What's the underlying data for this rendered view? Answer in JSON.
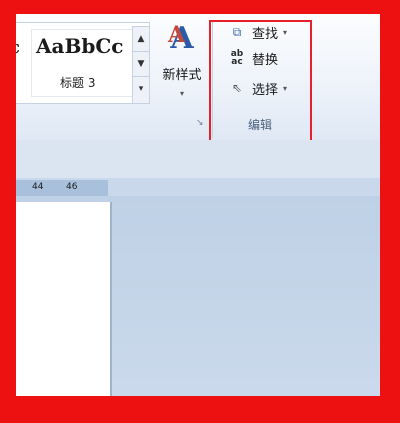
{
  "styles_gallery": {
    "preview_text": "AaBbCc",
    "caption": "标题 3",
    "sliver_text": "c",
    "scroll_up": "▲",
    "scroll_down": "▼",
    "more": "▾"
  },
  "new_style": {
    "label": "新样式",
    "dropdown_arrow": "▾",
    "icon": "style-letter-a-icon"
  },
  "styles_launcher": "↘",
  "editing_group": {
    "title": "编辑",
    "items": [
      {
        "label": "查找",
        "icon": "binoculars-icon",
        "has_dropdown": true,
        "arrow": "▾"
      },
      {
        "label": "替换",
        "icon": "replace-ab-icon",
        "has_dropdown": false
      },
      {
        "label": "选择",
        "icon": "cursor-arrow-icon",
        "has_dropdown": true,
        "arrow": "▾"
      }
    ]
  },
  "ruler": {
    "numbers": [
      "44",
      "46"
    ]
  },
  "colors": {
    "highlight_border": "#e8202a",
    "frame": "#ee1111",
    "ribbon_bg": "#eef3fa",
    "doc_bg": "#c9d8ea"
  }
}
